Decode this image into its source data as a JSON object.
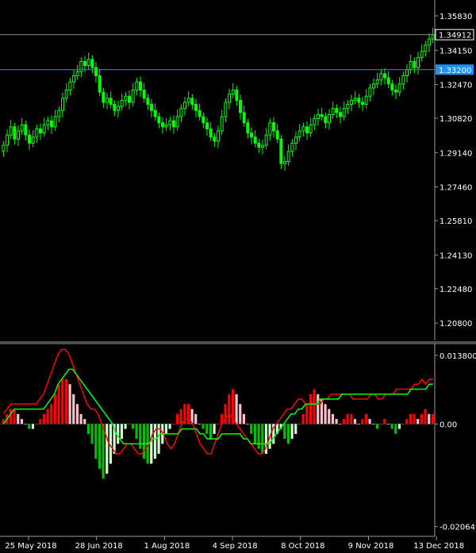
{
  "chart_data": [
    {
      "type": "candlestick",
      "y_ticks": [
        "1.35830",
        "1.34150",
        "1.32470",
        "1.30820",
        "1.29140",
        "1.27460",
        "1.25810",
        "1.24130",
        "1.22480",
        "1.20800"
      ],
      "ylim": [
        1.1995,
        1.3653
      ],
      "x_ticks": [
        "25 May 2018",
        "28 Jun 2018",
        "1 Aug 2018",
        "4 Sep 2018",
        "8 Oct 2018",
        "9 Nov 2018",
        "13 Dec 2018"
      ],
      "bid_label": "1.34912",
      "bid_value": 1.34912,
      "level_label": "1.33200",
      "level_value": 1.332,
      "colors": {
        "candle": "#00ff00",
        "bid_line": "#8a8a8a",
        "level_line": "#1e90ff",
        "level_label_bg": "#1e90ff"
      },
      "close": [
        1.295,
        1.3,
        1.304,
        1.298,
        1.302,
        1.305,
        1.3,
        1.296,
        1.299,
        1.303,
        1.301,
        1.305,
        1.307,
        1.304,
        1.309,
        1.312,
        1.318,
        1.322,
        1.326,
        1.329,
        1.331,
        1.336,
        1.334,
        1.337,
        1.333,
        1.329,
        1.321,
        1.316,
        1.318,
        1.315,
        1.312,
        1.314,
        1.317,
        1.319,
        1.316,
        1.322,
        1.326,
        1.322,
        1.318,
        1.315,
        1.312,
        1.309,
        1.306,
        1.304,
        1.305,
        1.307,
        1.304,
        1.309,
        1.313,
        1.316,
        1.318,
        1.315,
        1.312,
        1.309,
        1.306,
        1.303,
        1.299,
        1.297,
        1.302,
        1.309,
        1.316,
        1.32,
        1.322,
        1.317,
        1.311,
        1.306,
        1.301,
        1.299,
        1.296,
        1.294,
        1.295,
        1.3,
        1.306,
        1.302,
        1.298,
        1.286,
        1.287,
        1.292,
        1.296,
        1.299,
        1.302,
        1.304,
        1.301,
        1.305,
        1.308,
        1.31,
        1.309,
        1.306,
        1.31,
        1.313,
        1.311,
        1.309,
        1.313,
        1.315,
        1.317,
        1.318,
        1.316,
        1.315,
        1.319,
        1.323,
        1.325,
        1.327,
        1.33,
        1.328,
        1.325,
        1.322,
        1.321,
        1.325,
        1.329,
        1.332,
        1.336,
        1.333,
        1.338,
        1.341,
        1.344,
        1.347,
        1.349
      ]
    },
    {
      "type": "histogram_with_lines",
      "y_ticks": [
        "0.013800",
        "0.00",
        "-0.020649"
      ],
      "ylim": [
        -0.02165,
        0.0149
      ],
      "colors": {
        "hist_up": "#ff0000",
        "hist_up_light": "#ffc0cb",
        "hist_down": "#00c000",
        "hist_down_light": "#d0ffd0",
        "line_main": "#ff0000",
        "line_signal": "#00ff00",
        "zero_line": "#444444"
      },
      "histogram": [
        0.001,
        0.002,
        0.003,
        0.003,
        0.002,
        0.001,
        0.0,
        -0.001,
        -0.001,
        0.0,
        0.001,
        0.002,
        0.003,
        0.004,
        0.006,
        0.008,
        0.009,
        0.009,
        0.008,
        0.006,
        0.004,
        0.002,
        0.001,
        -0.002,
        -0.004,
        -0.007,
        -0.009,
        -0.011,
        -0.01,
        -0.008,
        -0.006,
        -0.004,
        -0.003,
        -0.001,
        0.0,
        -0.001,
        -0.003,
        -0.005,
        -0.007,
        -0.008,
        -0.008,
        -0.007,
        -0.006,
        -0.004,
        -0.002,
        -0.001,
        0.0,
        0.002,
        0.003,
        0.004,
        0.004,
        0.003,
        0.002,
        0.0,
        -0.001,
        -0.002,
        -0.003,
        -0.002,
        0.0,
        0.002,
        0.004,
        0.006,
        0.007,
        0.006,
        0.004,
        0.002,
        0.0,
        -0.002,
        -0.004,
        -0.005,
        -0.006,
        -0.006,
        -0.005,
        -0.004,
        -0.002,
        -0.001,
        -0.003,
        -0.004,
        -0.003,
        -0.002,
        0.0,
        0.002,
        0.004,
        0.006,
        0.007,
        0.006,
        0.005,
        0.004,
        0.003,
        0.002,
        0.001,
        0.0,
        0.001,
        0.002,
        0.002,
        0.001,
        0.0,
        0.001,
        0.002,
        0.001,
        0.0,
        -0.001,
        0.0,
        0.001,
        0.0,
        -0.001,
        -0.002,
        -0.001,
        0.0,
        0.001,
        0.002,
        0.002,
        0.001,
        0.002,
        0.003,
        0.002,
        0.002
      ],
      "line_main": [
        0.002,
        0.003,
        0.004,
        0.004,
        0.004,
        0.004,
        0.004,
        0.004,
        0.004,
        0.004,
        0.005,
        0.006,
        0.008,
        0.01,
        0.012,
        0.014,
        0.015,
        0.015,
        0.014,
        0.012,
        0.01,
        0.008,
        0.006,
        0.004,
        0.003,
        0.003,
        0.002,
        0.0,
        -0.002,
        -0.004,
        -0.005,
        -0.006,
        -0.006,
        -0.005,
        -0.004,
        -0.004,
        -0.005,
        -0.006,
        -0.006,
        -0.005,
        -0.004,
        -0.002,
        -0.001,
        -0.001,
        -0.002,
        -0.004,
        -0.005,
        -0.004,
        -0.002,
        0.0,
        0.001,
        0.001,
        0.0,
        -0.002,
        -0.004,
        -0.005,
        -0.006,
        -0.006,
        -0.004,
        -0.002,
        0.0,
        0.001,
        0.002,
        0.001,
        0.0,
        -0.001,
        -0.002,
        -0.003,
        -0.004,
        -0.005,
        -0.006,
        -0.006,
        -0.005,
        -0.003,
        -0.001,
        0.0,
        0.001,
        0.002,
        0.003,
        0.003,
        0.004,
        0.005,
        0.005,
        0.004,
        0.004,
        0.004,
        0.004,
        0.004,
        0.005,
        0.005,
        0.006,
        0.006,
        0.006,
        0.006,
        0.006,
        0.006,
        0.005,
        0.005,
        0.005,
        0.005,
        0.005,
        0.006,
        0.006,
        0.005,
        0.005,
        0.006,
        0.006,
        0.006,
        0.007,
        0.007,
        0.007,
        0.007,
        0.007,
        0.008,
        0.008,
        0.009,
        0.008,
        0.009,
        0.009
      ],
      "line_signal": [
        0.0,
        0.001,
        0.002,
        0.003,
        0.003,
        0.003,
        0.003,
        0.003,
        0.003,
        0.003,
        0.003,
        0.003,
        0.004,
        0.005,
        0.006,
        0.008,
        0.009,
        0.01,
        0.011,
        0.011,
        0.01,
        0.009,
        0.008,
        0.007,
        0.006,
        0.005,
        0.004,
        0.003,
        0.002,
        0.001,
        0.0,
        -0.002,
        -0.003,
        -0.004,
        -0.004,
        -0.004,
        -0.004,
        -0.004,
        -0.004,
        -0.004,
        -0.004,
        -0.003,
        -0.003,
        -0.002,
        -0.002,
        -0.002,
        -0.002,
        -0.002,
        -0.002,
        -0.001,
        -0.001,
        -0.001,
        -0.001,
        -0.001,
        -0.002,
        -0.002,
        -0.003,
        -0.003,
        -0.003,
        -0.003,
        -0.002,
        -0.002,
        -0.002,
        -0.002,
        -0.002,
        -0.002,
        -0.003,
        -0.003,
        -0.004,
        -0.004,
        -0.004,
        -0.004,
        -0.004,
        -0.004,
        -0.003,
        -0.002,
        -0.001,
        0.0,
        0.001,
        0.002,
        0.002,
        0.003,
        0.003,
        0.004,
        0.004,
        0.004,
        0.004,
        0.005,
        0.005,
        0.005,
        0.005,
        0.005,
        0.005,
        0.006,
        0.006,
        0.006,
        0.006,
        0.006,
        0.006,
        0.006,
        0.006,
        0.006,
        0.006,
        0.006,
        0.006,
        0.006,
        0.006,
        0.006,
        0.006,
        0.006,
        0.006,
        0.006,
        0.007,
        0.007,
        0.007,
        0.007,
        0.007,
        0.008,
        0.008
      ]
    }
  ]
}
